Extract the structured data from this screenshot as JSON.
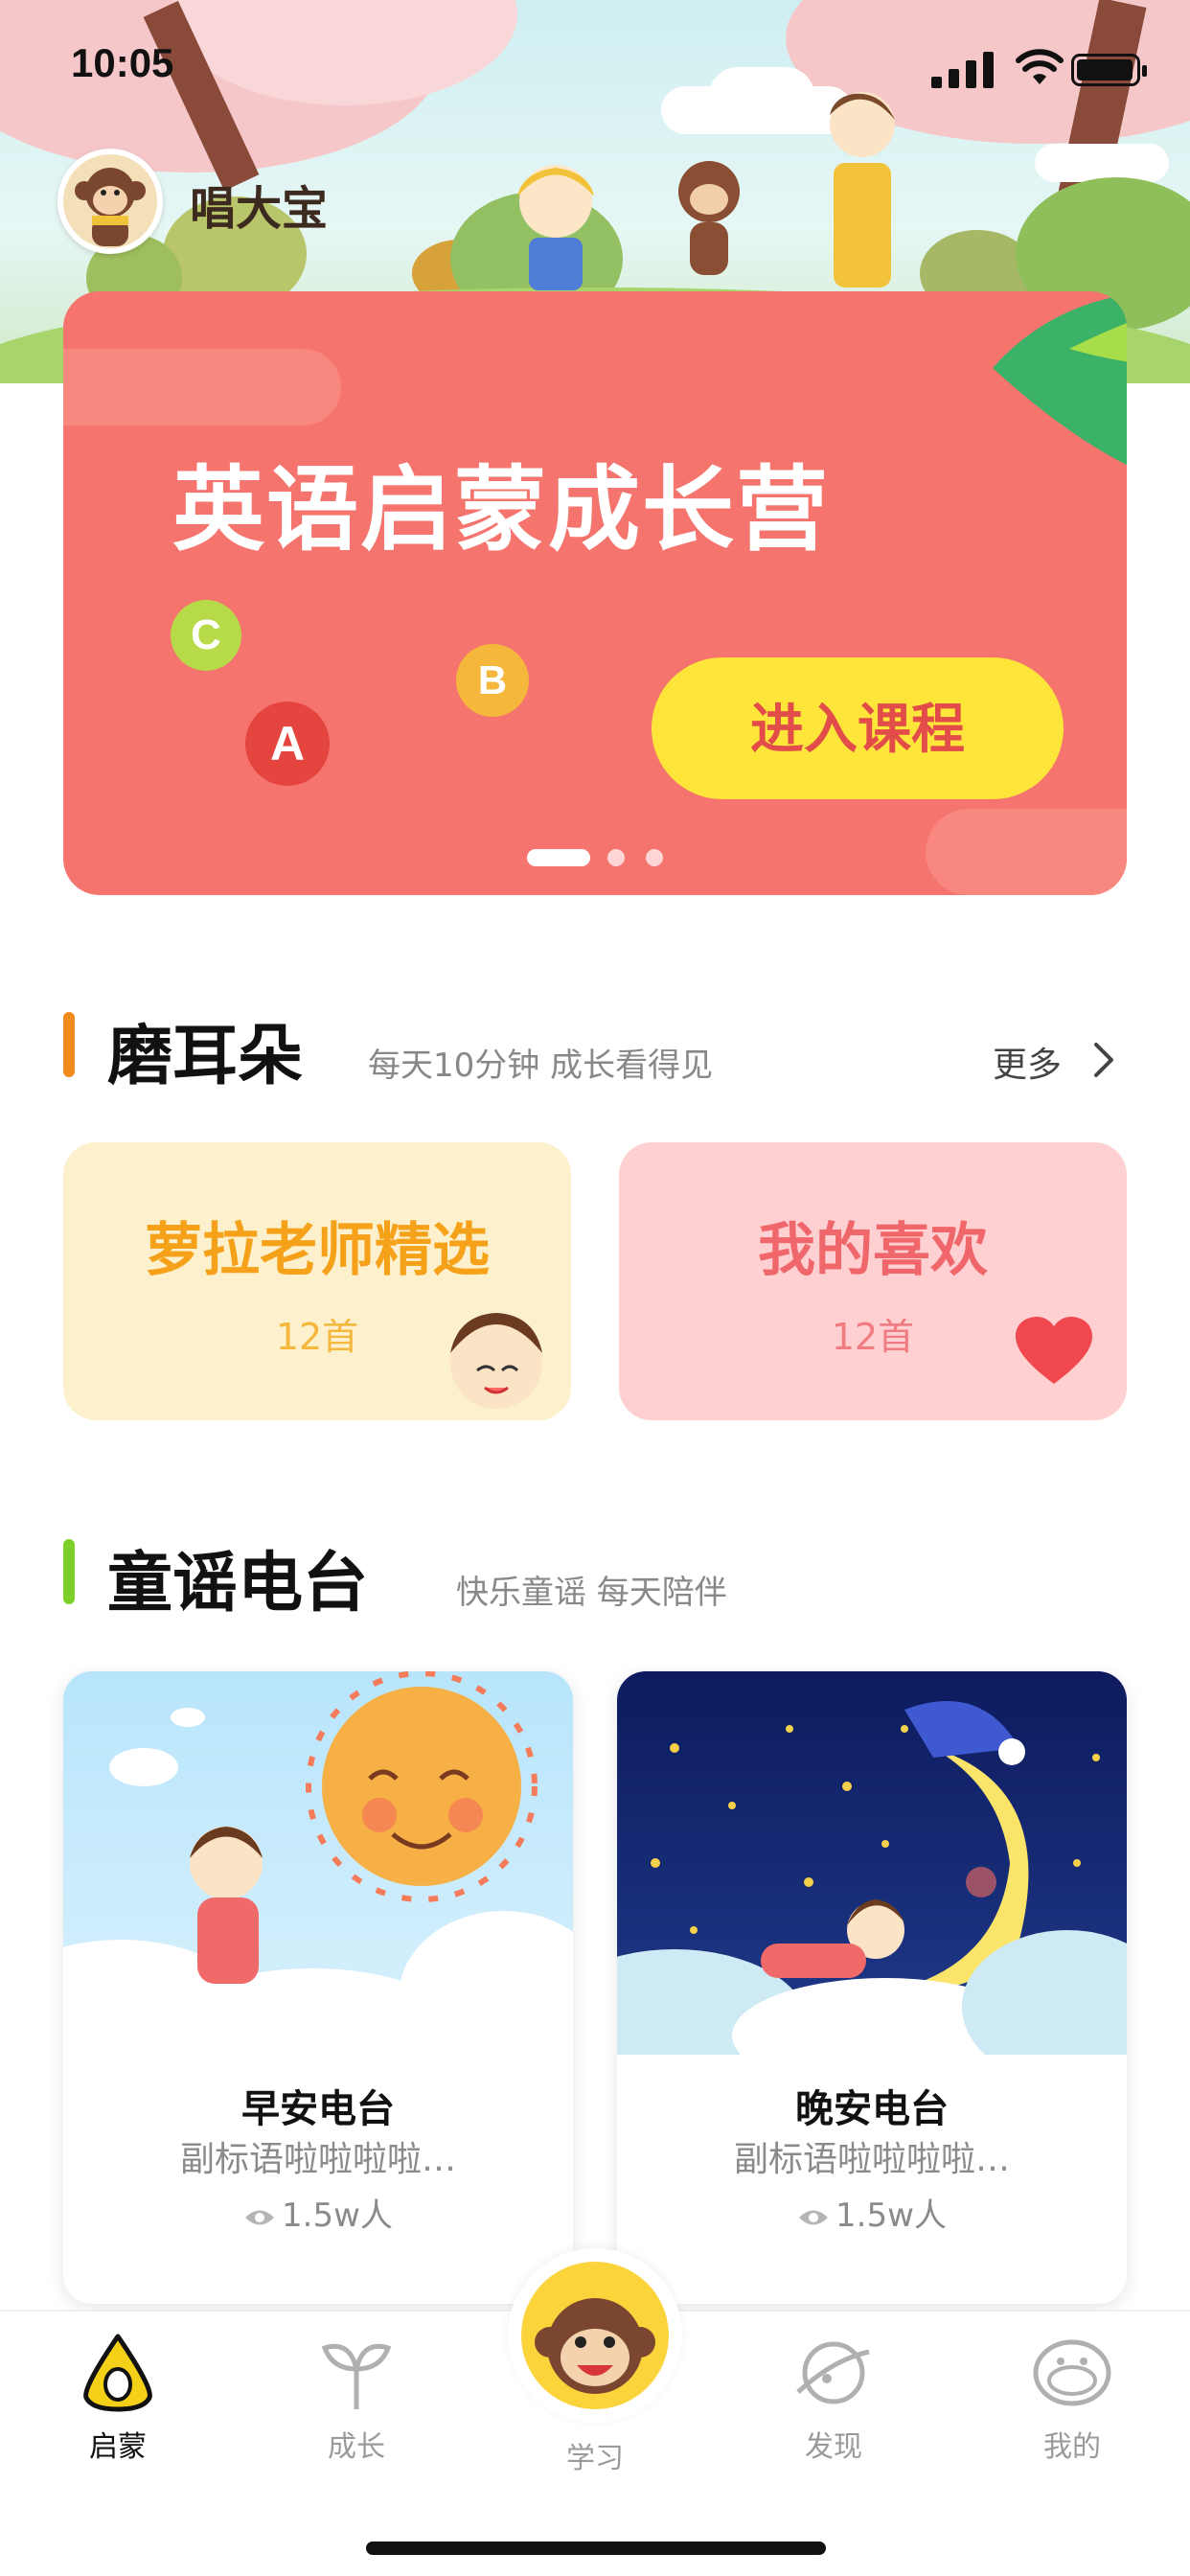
{
  "status_bar": {
    "time": "10:05"
  },
  "header": {
    "username": "唱大宝"
  },
  "banner": {
    "title": "英语启蒙成长营",
    "button_label": "进入课程",
    "letters": [
      "C",
      "A",
      "B"
    ]
  },
  "section_ear": {
    "title": "磨耳朵",
    "subtitle": "每天10分钟 成长看得见",
    "more_label": "更多",
    "cards": [
      {
        "title": "萝拉老师精选",
        "count": "12首"
      },
      {
        "title": "我的喜欢",
        "count": "12首"
      }
    ]
  },
  "section_radio": {
    "title": "童谣电台",
    "subtitle": "快乐童谣 每天陪伴",
    "cards": [
      {
        "title": "早安电台",
        "subtitle": "副标语啦啦啦啦…",
        "views": "1.5w人"
      },
      {
        "title": "晚安电台",
        "subtitle": "副标语啦啦啦啦…",
        "views": "1.5w人"
      }
    ]
  },
  "tabbar": {
    "tabs": [
      {
        "label": "启蒙",
        "icon": "egg-icon",
        "active": true
      },
      {
        "label": "成长",
        "icon": "sprout-icon",
        "active": false
      },
      {
        "label": "学习",
        "icon": "monkey-icon",
        "active": false
      },
      {
        "label": "发现",
        "icon": "planet-icon",
        "active": false
      },
      {
        "label": "我的",
        "icon": "face-icon",
        "active": false
      }
    ]
  },
  "colors": {
    "banner": "#f5746e",
    "button_yellow": "#fde53a",
    "accent_orange": "#f08a1c",
    "accent_green": "#7ccf2a",
    "card_yellow": "#fdf0cc",
    "card_pink": "#ffd0d2"
  }
}
